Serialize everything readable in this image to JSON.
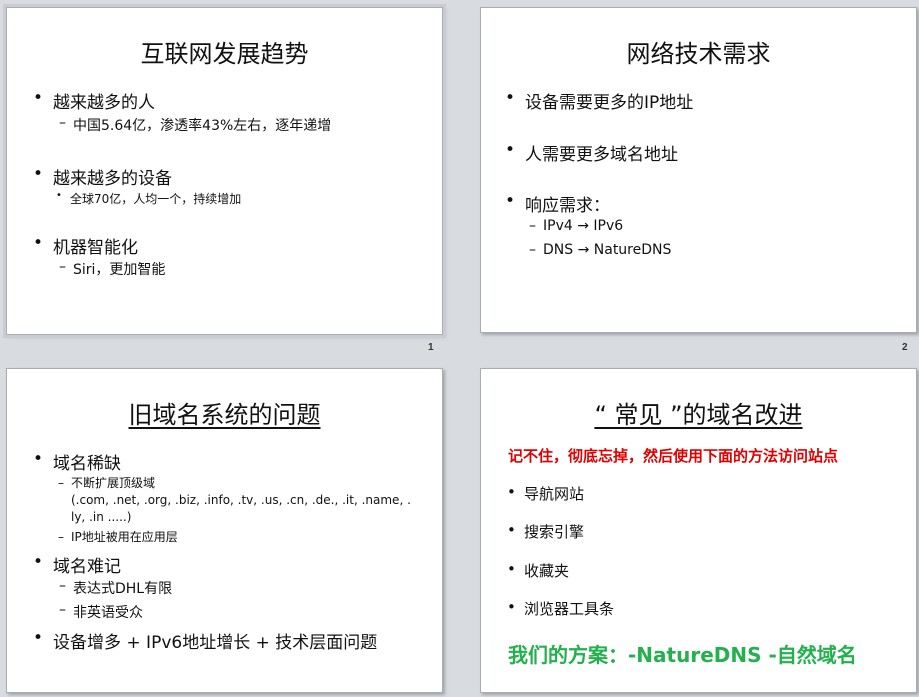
{
  "slides": [
    {
      "number": "1",
      "title": "互联网发展趋势",
      "items": [
        "越来越多的人",
        "中国5.64亿，渗透率43%左右，逐年递增",
        "越来越多的设备",
        "全球70亿，人均一个，持续增加",
        "机器智能化",
        "Siri，更加智能"
      ]
    },
    {
      "number": "2",
      "title": "网络技术需求",
      "items": [
        "设备需要更多的IP地址",
        "人需要更多域名地址",
        "响应需求：",
        "IPv4 → IPv6",
        "DNS → NatureDNS"
      ]
    },
    {
      "title": "旧域名系统的问题",
      "items": [
        "域名稀缺",
        "不断扩展顶级域",
        "(.com, .net, .org, .biz, .info, .tv, .us, .cn, .de., .it, .name, .",
        "ly, .in .....)",
        "IP地址被用在应用层",
        "域名难记",
        "表达式DHL有限",
        "非英语受众",
        "设备增多 + IPv6地址增长 + 技术层面问题"
      ]
    },
    {
      "title": "“ 常见 ”的域名改进",
      "red_line": "记不住，彻底忘掉，然后使用下面的方法访问站点",
      "items": [
        "导航网站",
        "搜索引擎",
        "收藏夹",
        "浏览器工具条"
      ],
      "green_line": "我们的方案：-NatureDNS -自然域名"
    }
  ],
  "colors": {
    "red": "#e00000",
    "green": "#22b14c",
    "background": "#d8dbe0"
  }
}
